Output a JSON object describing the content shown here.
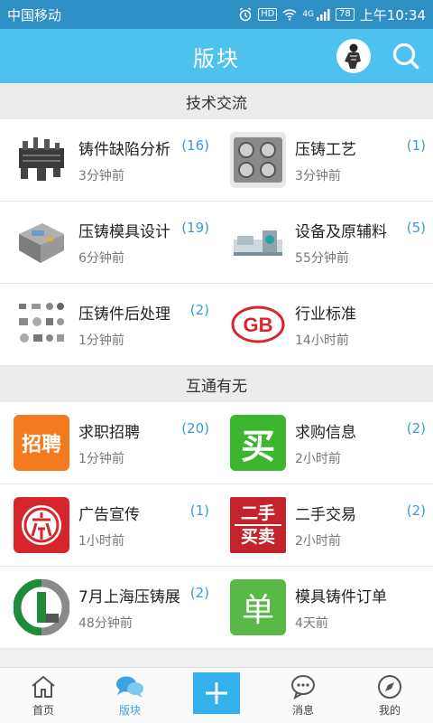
{
  "status_bar": {
    "carrier": "中国移动",
    "network": "4G",
    "battery": "78",
    "time": "上午10:34"
  },
  "header": {
    "title": "版块"
  },
  "sections": [
    {
      "title": "技术交流",
      "items": [
        {
          "name": "铸件缺陷分析",
          "count": "(16)",
          "time": "3分钟前",
          "icon": "casting-defect-image"
        },
        {
          "name": "压铸工艺",
          "count": "(1)",
          "time": "3分钟前",
          "icon": "engine-block-image"
        },
        {
          "name": "压铸模具设计",
          "count": "(19)",
          "time": "6分钟前",
          "icon": "die-mold-image"
        },
        {
          "name": "设备及原辅料",
          "count": "(5)",
          "time": "55分钟前",
          "icon": "machine-image"
        },
        {
          "name": "压铸件后处理",
          "count": "(2)",
          "time": "1分钟前",
          "icon": "parts-image"
        },
        {
          "name": "行业标准",
          "count": "",
          "time": "14小时前",
          "icon": "gb-logo"
        }
      ]
    },
    {
      "title": "互通有无",
      "items": [
        {
          "name": "求职招聘",
          "count": "(20)",
          "time": "1分钟前",
          "icon": "recruit-icon"
        },
        {
          "name": "求购信息",
          "count": "(2)",
          "time": "2小时前",
          "icon": "buy-icon"
        },
        {
          "name": "广告宣传",
          "count": "(1)",
          "time": "1小时前",
          "icon": "ad-icon"
        },
        {
          "name": "二手交易",
          "count": "(2)",
          "time": "2小时前",
          "icon": "second-hand-icon"
        },
        {
          "name": "7月上海压铸展",
          "count": "(2)",
          "time": "48分钟前",
          "icon": "expo-logo"
        },
        {
          "name": "模具铸件订单",
          "count": "",
          "time": "4天前",
          "icon": "order-icon"
        }
      ]
    }
  ],
  "icon_text": {
    "recruit": "招聘",
    "buy": "买",
    "second_hand_top": "二手",
    "second_hand_bottom": "买卖",
    "order": "单",
    "gb": "GB"
  },
  "bottom_nav": [
    {
      "label": "首页",
      "icon": "home-icon"
    },
    {
      "label": "版块",
      "icon": "chat-bubbles-icon",
      "active": true
    },
    {
      "label": "",
      "icon": "plus-icon"
    },
    {
      "label": "消息",
      "icon": "message-icon"
    },
    {
      "label": "我的",
      "icon": "compass-icon"
    }
  ],
  "colors": {
    "status_bar": "#2e8fc4",
    "header": "#4fc1ee",
    "accent": "#3aa4e0",
    "count": "#3a9ad9",
    "recruit": "#f47a20",
    "buy": "#3cb62f",
    "ad": "#d7262b",
    "second_hand": "#c4232b",
    "order": "#58b947"
  }
}
